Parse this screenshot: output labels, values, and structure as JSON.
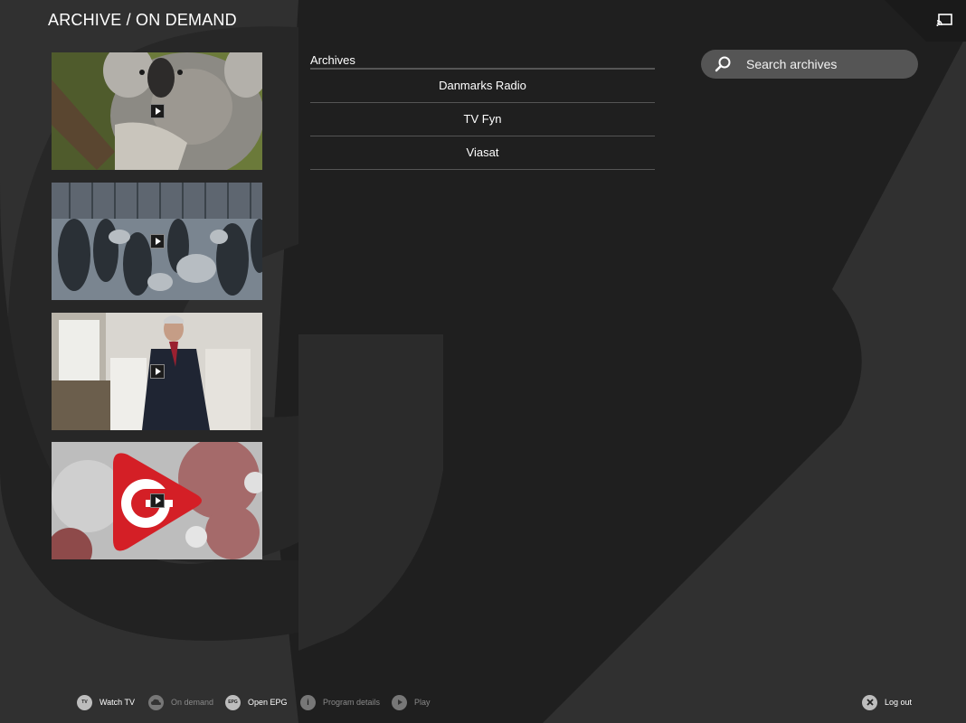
{
  "page": {
    "title": "ARCHIVE / ON DEMAND"
  },
  "thumbnails": [
    {
      "subject": "koala"
    },
    {
      "subject": "crowd"
    },
    {
      "subject": "man-in-suit"
    },
    {
      "subject": "logo"
    }
  ],
  "archives": {
    "heading": "Archives",
    "items": [
      "Danmarks Radio",
      "TV Fyn",
      "Viasat"
    ]
  },
  "search": {
    "placeholder": "Search archives",
    "value": ""
  },
  "footer": {
    "items": [
      {
        "icon": "TV",
        "label": "Watch TV",
        "active": true
      },
      {
        "icon": "",
        "label": "On demand",
        "active": false
      },
      {
        "icon": "EPG",
        "label": "Open EPG",
        "active": true
      },
      {
        "icon": "i",
        "label": "Program details",
        "active": false
      },
      {
        "icon": "",
        "label": "Play",
        "active": false
      }
    ],
    "logout": {
      "label": "Log out"
    }
  },
  "colors": {
    "background": "#2f2f2f",
    "accent_red": "#d41f26",
    "panel": "#555555"
  }
}
